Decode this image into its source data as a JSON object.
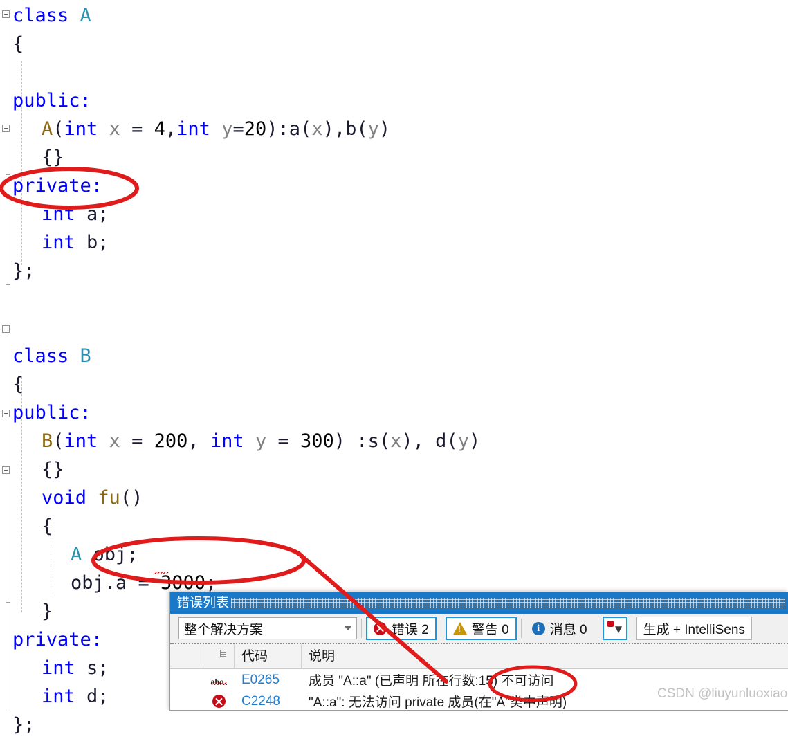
{
  "editor": {
    "language": "cpp",
    "lines": [
      {
        "indent": 0,
        "tokens": [
          {
            "t": "class ",
            "c": "kw"
          },
          {
            "t": "A",
            "c": "type"
          }
        ]
      },
      {
        "indent": 0,
        "tokens": [
          {
            "t": "{",
            "c": "plain"
          }
        ]
      },
      {
        "indent": 0,
        "tokens": []
      },
      {
        "indent": 0,
        "tokens": [
          {
            "t": "public:",
            "c": "kw"
          }
        ]
      },
      {
        "indent": 1,
        "tokens": [
          {
            "t": "A",
            "c": "ctor"
          },
          {
            "t": "(",
            "c": "plain"
          },
          {
            "t": "int",
            "c": "kw"
          },
          {
            "t": " ",
            "c": "plain"
          },
          {
            "t": "x",
            "c": "param"
          },
          {
            "t": " = ",
            "c": "plain"
          },
          {
            "t": "4",
            "c": "num"
          },
          {
            "t": ",",
            "c": "plain"
          },
          {
            "t": "int",
            "c": "kw"
          },
          {
            "t": " ",
            "c": "plain"
          },
          {
            "t": "y",
            "c": "param"
          },
          {
            "t": "=",
            "c": "plain"
          },
          {
            "t": "20",
            "c": "num"
          },
          {
            "t": ")",
            "c": "plain"
          },
          {
            "t": ":",
            "c": "plain"
          },
          {
            "t": "a",
            "c": "plain"
          },
          {
            "t": "(",
            "c": "plain"
          },
          {
            "t": "x",
            "c": "param"
          },
          {
            "t": ")",
            "c": "plain"
          },
          {
            "t": ",",
            "c": "plain"
          },
          {
            "t": "b",
            "c": "plain"
          },
          {
            "t": "(",
            "c": "plain"
          },
          {
            "t": "y",
            "c": "param"
          },
          {
            "t": ")",
            "c": "plain"
          }
        ]
      },
      {
        "indent": 1,
        "tokens": [
          {
            "t": "{}",
            "c": "plain"
          }
        ]
      },
      {
        "indent": 0,
        "tokens": [
          {
            "t": "private:",
            "c": "kw"
          }
        ]
      },
      {
        "indent": 1,
        "tokens": [
          {
            "t": "int",
            "c": "kw"
          },
          {
            "t": " a;",
            "c": "plain"
          }
        ]
      },
      {
        "indent": 1,
        "tokens": [
          {
            "t": "int",
            "c": "kw"
          },
          {
            "t": " b;",
            "c": "plain"
          }
        ]
      },
      {
        "indent": 0,
        "tokens": [
          {
            "t": "};",
            "c": "plain"
          }
        ]
      },
      {
        "indent": 0,
        "tokens": []
      },
      {
        "indent": 0,
        "tokens": []
      },
      {
        "indent": 0,
        "tokens": [
          {
            "t": "class ",
            "c": "kw"
          },
          {
            "t": "B",
            "c": "type"
          }
        ]
      },
      {
        "indent": 0,
        "tokens": [
          {
            "t": "{",
            "c": "plain"
          }
        ]
      },
      {
        "indent": 0,
        "tokens": [
          {
            "t": "public:",
            "c": "kw"
          }
        ]
      },
      {
        "indent": 1,
        "tokens": [
          {
            "t": "B",
            "c": "ctor"
          },
          {
            "t": "(",
            "c": "plain"
          },
          {
            "t": "int",
            "c": "kw"
          },
          {
            "t": " ",
            "c": "plain"
          },
          {
            "t": "x",
            "c": "param"
          },
          {
            "t": " = ",
            "c": "plain"
          },
          {
            "t": "200",
            "c": "num"
          },
          {
            "t": ", ",
            "c": "plain"
          },
          {
            "t": "int",
            "c": "kw"
          },
          {
            "t": " ",
            "c": "plain"
          },
          {
            "t": "y",
            "c": "param"
          },
          {
            "t": " = ",
            "c": "plain"
          },
          {
            "t": "300",
            "c": "num"
          },
          {
            "t": ") :",
            "c": "plain"
          },
          {
            "t": "s",
            "c": "plain"
          },
          {
            "t": "(",
            "c": "plain"
          },
          {
            "t": "x",
            "c": "param"
          },
          {
            "t": "), ",
            "c": "plain"
          },
          {
            "t": "d",
            "c": "plain"
          },
          {
            "t": "(",
            "c": "plain"
          },
          {
            "t": "y",
            "c": "param"
          },
          {
            "t": ")",
            "c": "plain"
          }
        ]
      },
      {
        "indent": 1,
        "tokens": [
          {
            "t": "{}",
            "c": "plain"
          }
        ]
      },
      {
        "indent": 1,
        "tokens": [
          {
            "t": "void",
            "c": "kw"
          },
          {
            "t": " ",
            "c": "plain"
          },
          {
            "t": "fu",
            "c": "ctor"
          },
          {
            "t": "()",
            "c": "plain"
          }
        ]
      },
      {
        "indent": 1,
        "tokens": [
          {
            "t": "{",
            "c": "plain"
          }
        ]
      },
      {
        "indent": 2,
        "tokens": [
          {
            "t": "A",
            "c": "type"
          },
          {
            "t": " obj;",
            "c": "plain"
          }
        ]
      },
      {
        "indent": 2,
        "tokens": [
          {
            "t": "obj.a = ",
            "c": "plain"
          },
          {
            "t": "3000",
            "c": "num"
          },
          {
            "t": ";",
            "c": "plain"
          }
        ]
      },
      {
        "indent": 1,
        "tokens": [
          {
            "t": "}",
            "c": "plain"
          }
        ]
      },
      {
        "indent": 0,
        "tokens": [
          {
            "t": "private:",
            "c": "kw"
          }
        ]
      },
      {
        "indent": 1,
        "tokens": [
          {
            "t": "int",
            "c": "kw"
          },
          {
            "t": " s;",
            "c": "plain"
          }
        ]
      },
      {
        "indent": 1,
        "tokens": [
          {
            "t": "int",
            "c": "kw"
          },
          {
            "t": " d;",
            "c": "plain"
          }
        ]
      },
      {
        "indent": 0,
        "tokens": [
          {
            "t": "};",
            "c": "plain"
          }
        ]
      }
    ]
  },
  "error_panel": {
    "title": "错误列表",
    "scope_filter": {
      "value": "整个解决方案"
    },
    "toolbar": {
      "errors_label": "错误 2",
      "warnings_label": "警告 0",
      "messages_label": "消息 0",
      "filter_icon_name": "error-filter-icon",
      "build_source_label": "生成 + IntelliSens"
    },
    "columns": [
      {
        "key": "blank",
        "label": ""
      },
      {
        "key": "severity",
        "label": ""
      },
      {
        "key": "code",
        "label": "代码"
      },
      {
        "key": "description",
        "label": "说明"
      }
    ],
    "rows": [
      {
        "icon": "abc-squiggle-icon",
        "code": "E0265",
        "description": "成员 \"A::a\" (已声明 所在行数:15) 不可访问"
      },
      {
        "icon": "error-x-icon",
        "code": "C2248",
        "description": "\"A::a\": 无法访问 private 成员(在\"A\"类中声明)"
      }
    ]
  },
  "annotations": {
    "ink_color": "#e01b1b",
    "ellipse_private_target": "private:",
    "ellipse_objassign_target": "obj.a = 3000;",
    "ellipse_inaccessible_target": "不可访问",
    "arrow_from": "obj.a = 3000;",
    "arrow_to": "E0265 不可访问"
  },
  "watermark": {
    "text": "CSDN @liuyunluoxiao"
  },
  "theme": {
    "keyword_color": "#0000ff",
    "type_color": "#2b91af",
    "ctor_color": "#8b6914",
    "param_color": "#808080",
    "panel_title_bg": "#1978c8",
    "accent_blue": "#2196dd",
    "error_red": "#c80a17",
    "warn_amber": "#c9960b",
    "info_blue": "#1e6fb8",
    "link_blue": "#1e7fd4"
  }
}
